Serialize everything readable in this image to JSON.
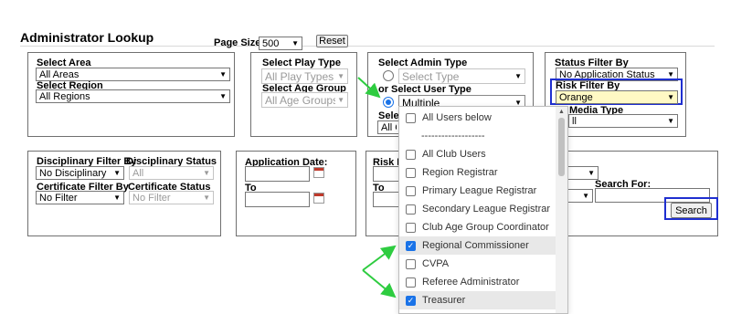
{
  "page": {
    "title": "Administrator Lookup"
  },
  "pagesize": {
    "label": "Page Size:",
    "value": "500",
    "reset_label": "Reset"
  },
  "area": {
    "label": "Select Area",
    "value": "All Areas",
    "region_label": "Select Region",
    "region_value": "All Regions"
  },
  "play": {
    "label": "Select Play Type",
    "value": "All Play Types",
    "age_label": "Select Age Group",
    "age_value": "All Age Groups"
  },
  "admin": {
    "label": "Select Admin Type",
    "type_placeholder": "Select Type",
    "or_label": "or Select User Type",
    "user_value": "Multiple",
    "partial_label": "Selec",
    "partial_value": "All C"
  },
  "status": {
    "label": "Status Filter By",
    "value": "No Application Status",
    "risk_label": "Risk Filter By",
    "risk_value": "Orange",
    "media_label": "Media Type",
    "media_partial": "ll"
  },
  "disc": {
    "filter_label": "Disciplinary Filter By",
    "status_label": "Disciplinary Status",
    "filter_value": "No Disciplinary",
    "status_value": "All",
    "cert_label": "Certificate Filter By",
    "cert_status_label": "Certificate Status",
    "cert_value": "No Filter",
    "cert_status_value": "No Filter"
  },
  "appdate": {
    "label": "Application Date:",
    "to_label": "To"
  },
  "riskb": {
    "label": "Risk B",
    "to_label": "To"
  },
  "search": {
    "label": "Search For:",
    "button": "Search"
  },
  "dropdown": {
    "options": [
      {
        "label": "All Users below",
        "checked": false
      },
      {
        "label": "-------------------",
        "checked": false,
        "separator": true
      },
      {
        "label": "All Club Users",
        "checked": false
      },
      {
        "label": "Region Registrar",
        "checked": false
      },
      {
        "label": "Primary League Registrar",
        "checked": false
      },
      {
        "label": "Secondary League Registrar",
        "checked": false
      },
      {
        "label": "Club Age Group Coordinator",
        "checked": false
      },
      {
        "label": "Regional Commissioner",
        "checked": true
      },
      {
        "label": "CVPA",
        "checked": false
      },
      {
        "label": "Referee Administrator",
        "checked": false
      },
      {
        "label": "Treasurer",
        "checked": true
      }
    ]
  },
  "colors": {
    "highlight": "#1f2fd0",
    "arrow": "#2ecc40",
    "risk_bg": "#fff9c4",
    "check": "#1a73e8"
  }
}
